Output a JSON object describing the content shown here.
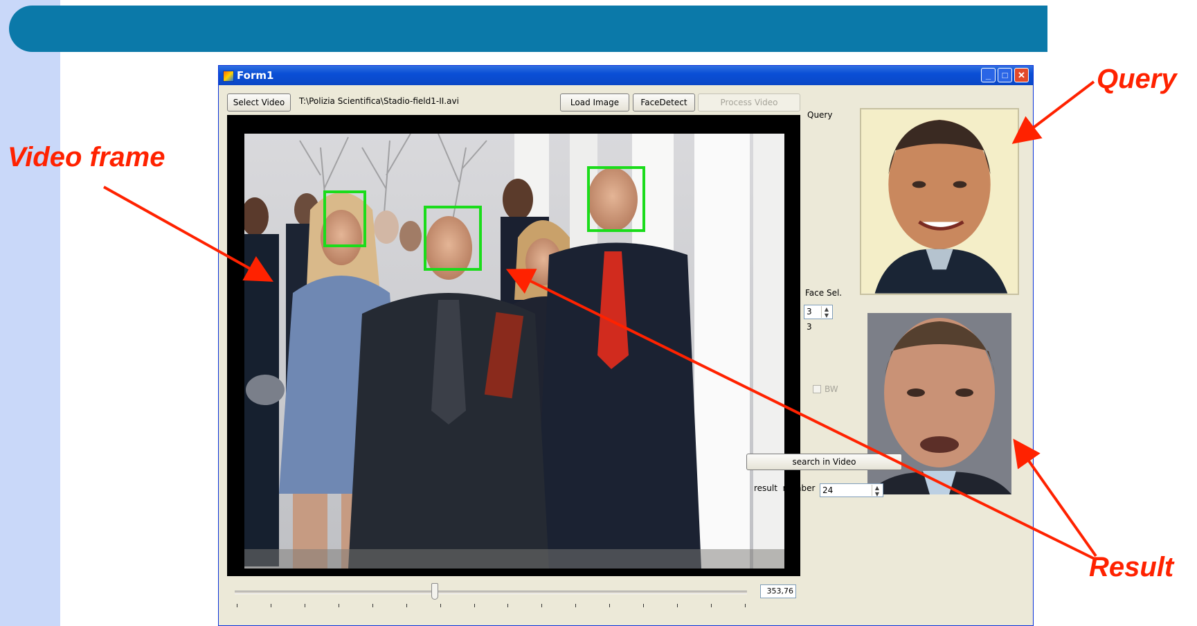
{
  "annotations": {
    "video_frame": "Video frame",
    "query": "Query",
    "result": "Result"
  },
  "window": {
    "title": "Form1",
    "minimize_glyph": "_",
    "maximize_glyph": "□",
    "close_glyph": "✕"
  },
  "toolbar": {
    "select_video": "Select Video",
    "file_path": "T:\\Polizia Scientifica\\Stadio-field1-II.avi",
    "load_image": "Load Image",
    "face_detect": "FaceDetect",
    "process_video": "Process Video"
  },
  "right_panel": {
    "query_label": "Query",
    "face_sel_label": "Face Sel.",
    "face_sel_value": "3",
    "face_sel_readout": "3",
    "bw_label": "BW",
    "search_button": "search in Video",
    "result_number_label": "result  number",
    "result_number_value": "24"
  },
  "slider": {
    "value_text": "353,76",
    "position_fraction": 0.39
  },
  "colors": {
    "annotation": "#ff2200",
    "face_box": "#1bdc1b",
    "band_top": "#0b79a9",
    "band_left": "#c9d8f9"
  }
}
